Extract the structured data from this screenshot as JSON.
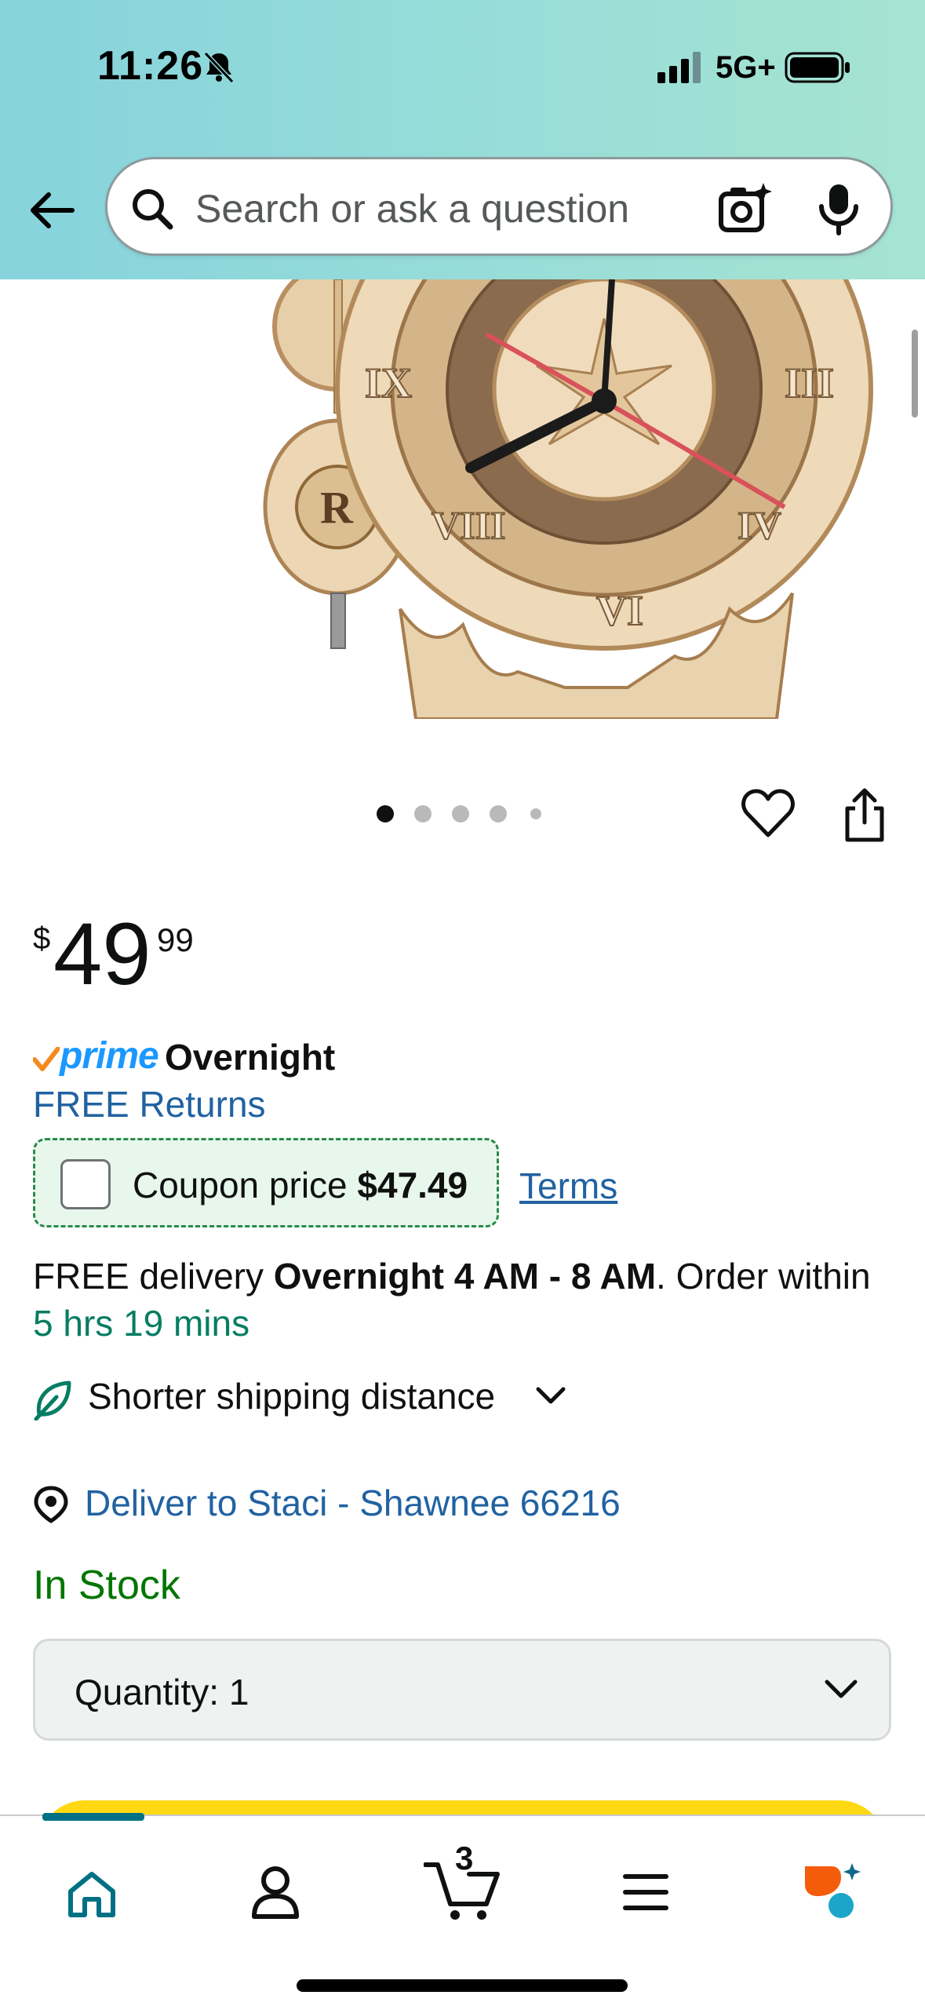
{
  "status_bar": {
    "time": "11:26",
    "network": "5G+"
  },
  "search": {
    "placeholder": "Search or ask a question"
  },
  "carousel": {
    "page_count": 5,
    "active_index": 0
  },
  "price": {
    "currency": "$",
    "whole": "49",
    "fraction": "99"
  },
  "prime": {
    "brand": "prime",
    "label": "Overnight"
  },
  "returns": {
    "label": "FREE Returns"
  },
  "coupon": {
    "label": "Coupon price",
    "price": "$47.49",
    "terms": "Terms",
    "checked": false
  },
  "delivery": {
    "prefix": "FREE delivery ",
    "window": "Overnight 4 AM - 8 AM",
    "middle": ". Order within ",
    "countdown": "5 hrs 19 mins"
  },
  "shipping": {
    "label": "Shorter shipping distance"
  },
  "deliver_to": {
    "label": "Deliver to Staci - Shawnee 66216"
  },
  "stock": {
    "label": "In Stock"
  },
  "quantity": {
    "label": "Quantity:",
    "value": "1"
  },
  "bottom_nav": {
    "items": [
      "home",
      "account",
      "cart",
      "menu",
      "rufus"
    ],
    "cart_count": "3"
  },
  "colors": {
    "header_gradient_start": "#86d3dc",
    "header_gradient_end": "#a6e4d1",
    "link": "#2162a1",
    "stock_green": "#007600",
    "countdown_green": "#067d62",
    "prime_blue": "#1a98ff",
    "buy_yellow": "#ffd814",
    "nav_accent": "#007185"
  }
}
